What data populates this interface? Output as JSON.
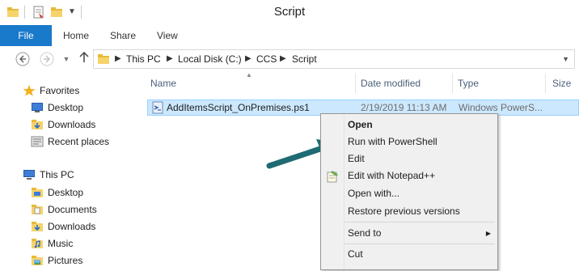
{
  "window": {
    "title": "Script"
  },
  "ribbon": {
    "tabs": [
      "File",
      "Home",
      "Share",
      "View"
    ]
  },
  "address": {
    "crumbs": [
      "This PC",
      "Local Disk (C:)",
      "CCS",
      "Script"
    ]
  },
  "sidebar": {
    "favorites": {
      "label": "Favorites",
      "items": [
        "Desktop",
        "Downloads",
        "Recent places"
      ]
    },
    "thispc": {
      "label": "This PC",
      "items": [
        "Desktop",
        "Documents",
        "Downloads",
        "Music",
        "Pictures"
      ]
    }
  },
  "columns": [
    "Name",
    "Date modified",
    "Type",
    "Size"
  ],
  "file": {
    "name": "AddItemsScript_OnPremises.ps1",
    "date": "2/19/2019 11:13 AM",
    "type": "Windows PowerS..."
  },
  "context_menu": {
    "items": [
      "Open",
      "Run with PowerShell",
      "Edit",
      "Edit with Notepad++",
      "Open with...",
      "Restore previous versions",
      "Send to",
      "Cut"
    ]
  },
  "colors": {
    "accent": "#1979ca",
    "selection": "#cce8ff",
    "arrow": "#1f6b73"
  }
}
